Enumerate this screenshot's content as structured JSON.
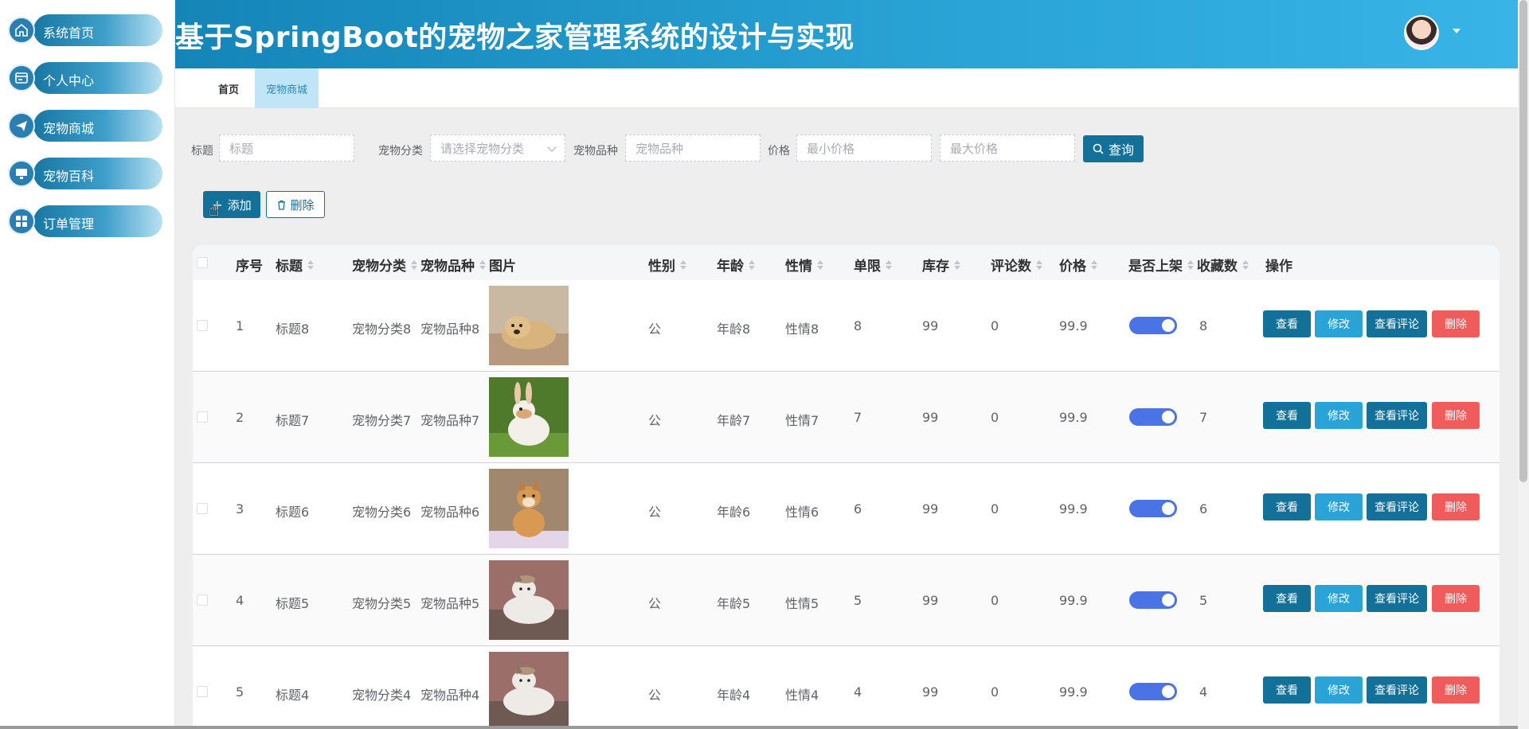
{
  "sidebar": {
    "items": [
      {
        "label": "系统首页",
        "icon": "home-icon"
      },
      {
        "label": "个人中心",
        "icon": "id-card-icon"
      },
      {
        "label": "宠物商城",
        "icon": "paper-plane-icon"
      },
      {
        "label": "宠物百科",
        "icon": "monitor-icon"
      },
      {
        "label": "订单管理",
        "icon": "grid-icon"
      }
    ]
  },
  "header": {
    "title": "基于SpringBoot的宠物之家管理系统的设计与实现",
    "avatar_icon": "user-avatar"
  },
  "tabs": [
    {
      "label": "首页"
    },
    {
      "label": "宠物商城"
    }
  ],
  "filters": {
    "title_label": "标题",
    "title_placeholder": "标题",
    "category_label": "宠物分类",
    "category_placeholder": "请选择宠物分类",
    "breed_label": "宠物品种",
    "breed_placeholder": "宠物品种",
    "price_label": "价格",
    "min_price_placeholder": "最小价格",
    "max_price_placeholder": "最大价格",
    "query_label": "查询"
  },
  "toolbar": {
    "add_label": "添加",
    "delete_label": "删除"
  },
  "table": {
    "headers": {
      "index": "序号",
      "title": "标题",
      "category": "宠物分类",
      "breed": "宠物品种",
      "image": "图片",
      "gender": "性别",
      "age": "年龄",
      "temper": "性情",
      "limit": "单限",
      "stock": "库存",
      "comments": "评论数",
      "price": "价格",
      "on_shelf": "是否上架",
      "favorites": "收藏数",
      "actions": "操作"
    },
    "rows": [
      {
        "index": "1",
        "title": "标题8",
        "category": "宠物分类8",
        "breed": "宠物品种8",
        "image": "puppy-photo",
        "gender": "公",
        "age": "年龄8",
        "temper": "性情8",
        "limit": "8",
        "stock": "99",
        "comments": "0",
        "price": "99.9",
        "on_shelf": true,
        "favorites": "8"
      },
      {
        "index": "2",
        "title": "标题7",
        "category": "宠物分类7",
        "breed": "宠物品种7",
        "image": "rabbit-photo",
        "gender": "公",
        "age": "年龄7",
        "temper": "性情7",
        "limit": "7",
        "stock": "99",
        "comments": "0",
        "price": "99.9",
        "on_shelf": true,
        "favorites": "7"
      },
      {
        "index": "3",
        "title": "标题6",
        "category": "宠物分类6",
        "breed": "宠物品种6",
        "image": "shiba-photo",
        "gender": "公",
        "age": "年龄6",
        "temper": "性情6",
        "limit": "6",
        "stock": "99",
        "comments": "0",
        "price": "99.9",
        "on_shelf": true,
        "favorites": "6"
      },
      {
        "index": "4",
        "title": "标题5",
        "category": "宠物分类5",
        "breed": "宠物品种5",
        "image": "cat-photo",
        "gender": "公",
        "age": "年龄5",
        "temper": "性情5",
        "limit": "5",
        "stock": "99",
        "comments": "0",
        "price": "99.9",
        "on_shelf": true,
        "favorites": "5"
      },
      {
        "index": "5",
        "title": "标题4",
        "category": "宠物分类4",
        "breed": "宠物品种4",
        "image": "cat-photo",
        "gender": "公",
        "age": "年龄4",
        "temper": "性情4",
        "limit": "4",
        "stock": "99",
        "comments": "0",
        "price": "99.9",
        "on_shelf": true,
        "favorites": "4"
      }
    ],
    "actions": {
      "view": "查看",
      "edit": "修改",
      "comments": "查看评论",
      "delete": "删除"
    }
  },
  "colors": {
    "primary": "#137199",
    "accent": "#2aa4d6",
    "danger": "#f05b5b",
    "switch_on": "#4a73e6"
  }
}
